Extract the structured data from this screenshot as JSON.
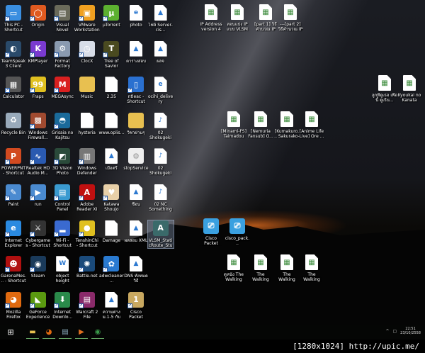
{
  "desktop": {
    "grid": [
      {
        "label": "This PC - Shortcut",
        "icon": "computer-icon",
        "color": "#3a8ee0",
        "glyph": "▭"
      },
      {
        "label": "Origin",
        "icon": "origin-icon",
        "color": "#e05a20",
        "glyph": "◯"
      },
      {
        "label": "Visual Novel Reader - S...",
        "icon": "vnr-icon",
        "color": "#6a6a5a",
        "glyph": "▤"
      },
      {
        "label": "VMware Workstation",
        "icon": "vmware-icon",
        "color": "#f0a020",
        "glyph": "▣"
      },
      {
        "label": "µTorrent",
        "icon": "utorrent-icon",
        "color": "#5cb030",
        "glyph": "µ"
      },
      {
        "label": "photo",
        "icon": "dreamweaver-file-icon",
        "color": "doc",
        "glyph": "e"
      },
      {
        "label": "ไฟล์ Server-cis...",
        "icon": "image-file-icon",
        "color": "doc",
        "glyph": "▲"
      },
      {
        "label": "TeamSpeak 3 Client",
        "icon": "teamspeak-icon",
        "color": "#2a4a6a",
        "glyph": "◐"
      },
      {
        "label": "KMPlayer",
        "icon": "kmplayer-icon",
        "color": "#7a3ad0",
        "glyph": "K"
      },
      {
        "label": "Format Factory",
        "icon": "format-factory-icon",
        "color": "#8a9ab0",
        "glyph": "⚙"
      },
      {
        "label": "ClocX",
        "icon": "clock-icon",
        "color": "#d8dde8",
        "glyph": "◷"
      },
      {
        "label": "Tree of Savior (English Ver.)",
        "icon": "tree-of-savior-icon",
        "color": "#4a4a20",
        "glyph": "T"
      },
      {
        "label": "ตารางสอบ",
        "icon": "image-file-icon",
        "color": "doc",
        "glyph": "▲"
      },
      {
        "label": "ผลจ",
        "icon": "image-file-icon",
        "color": "doc",
        "glyph": "▲"
      },
      {
        "label": "Calculator",
        "icon": "calculator-icon",
        "color": "#555",
        "glyph": "▦"
      },
      {
        "label": "Fraps",
        "icon": "fraps-icon",
        "color": "#e0c020",
        "glyph": "99"
      },
      {
        "label": "MEGAsync",
        "icon": "mega-icon",
        "color": "#d92020",
        "glyph": "M"
      },
      {
        "label": "Music",
        "icon": "folder-icon",
        "color": "#e8c050",
        "glyph": ""
      },
      {
        "label": "2.35",
        "icon": "blank-file-icon",
        "color": "doc",
        "glyph": ""
      },
      {
        "label": "ntleac - Shortcut",
        "icon": "window-icon",
        "color": "#2a70d0",
        "glyph": "▯"
      },
      {
        "label": "ocihi_delivery",
        "icon": "pdf-file-icon",
        "color": "doc",
        "glyph": "e"
      },
      {
        "label": "Recycle Bin",
        "icon": "recycle-bin-icon",
        "color": "#9ab",
        "glyph": "♻"
      },
      {
        "label": "Windows Firewall...",
        "icon": "firewall-icon",
        "color": "#a04a30",
        "glyph": "▩"
      },
      {
        "label": "Grisaia no Kajitsu",
        "icon": "grisaia-icon",
        "color": "#1a6a9a",
        "glyph": "◓"
      },
      {
        "label": "hysteria",
        "icon": "blank-file-icon",
        "color": "doc",
        "glyph": ""
      },
      {
        "label": "www.oplis...",
        "icon": "blank-file-icon",
        "color": "doc",
        "glyph": ""
      },
      {
        "label": "วิชาผ่านๆ",
        "icon": "folder-icon",
        "color": "#e8c050",
        "glyph": ""
      },
      {
        "label": "02 Shokugeki no Soma E...",
        "icon": "mp3-file-icon",
        "color": "doc",
        "glyph": "♪"
      },
      {
        "label": "POWERPNT - Shortcut",
        "icon": "powerpoint-icon",
        "color": "#d24a20",
        "glyph": "P"
      },
      {
        "label": "Realtek HD Audio M...",
        "icon": "realtek-icon",
        "color": "#2a5ab0",
        "glyph": "∿"
      },
      {
        "label": "3D Vision Photo Viewer",
        "icon": "3d-vision-icon",
        "color": "#2a4a3a",
        "glyph": "◩"
      },
      {
        "label": "Windows Defender",
        "icon": "defender-icon",
        "color": "#777",
        "glyph": "▥"
      },
      {
        "label": "เมื่อตรี",
        "icon": "image-file-icon",
        "color": "doc",
        "glyph": "▲"
      },
      {
        "label": "stopService",
        "icon": "settings-file-icon",
        "color": "#eee",
        "glyph": "⚙"
      },
      {
        "label": "02 Shokugeki no Soma E...",
        "icon": "mp3-file-icon",
        "color": "doc",
        "glyph": "♪"
      },
      {
        "label": "Paint",
        "icon": "paint-icon",
        "color": "#4a8ad0",
        "glyph": "✎"
      },
      {
        "label": "run",
        "icon": "run-icon",
        "color": "#4a8ad0",
        "glyph": "▶"
      },
      {
        "label": "Control Panel",
        "icon": "control-panel-icon",
        "color": "#3a9ad0",
        "glyph": "▤"
      },
      {
        "label": "Adobe Reader XI",
        "icon": "adobe-reader-icon",
        "color": "#c01010",
        "glyph": "A"
      },
      {
        "label": "Katawa Shoujo",
        "icon": "heart-icon",
        "color": "#e8d0a8",
        "glyph": "♥"
      },
      {
        "label": "ชื่อน",
        "icon": "image-file-icon",
        "color": "doc",
        "glyph": "▲"
      },
      {
        "label": "02 NC Something ...",
        "icon": "mp3-file-icon",
        "color": "doc",
        "glyph": "♪"
      },
      {
        "label": "Internet Explorer",
        "icon": "internet-explorer-icon",
        "color": "#2a8ae0",
        "glyph": "e"
      },
      {
        "label": "Cybergames - Shortcut",
        "icon": "cybergames-icon",
        "color": "#333",
        "glyph": "⚔"
      },
      {
        "label": "Wi-Fi - Shortcut",
        "icon": "wifi-icon",
        "color": "#3a6ad0",
        "glyph": "▂"
      },
      {
        "label": "TenshinChi - Shortcut",
        "icon": "tenshin-icon",
        "color": "#e0c020",
        "glyph": "●"
      },
      {
        "label": "Damage",
        "icon": "blank-file-icon",
        "color": "doc",
        "glyph": ""
      },
      {
        "label": "ผลสอบ XML",
        "icon": "image-file-icon",
        "color": "doc",
        "glyph": "▲"
      },
      {
        "label": "VLSM_StaticRoute_Student",
        "icon": "packet-tracer-file-icon",
        "color": "#3a6a6a",
        "glyph": "A",
        "selected": true
      },
      {
        "label": "GarenaMes... - Shortcut",
        "icon": "garena-icon",
        "color": "#b01010",
        "glyph": "☻"
      },
      {
        "label": "Steam",
        "icon": "steam-icon",
        "color": "#1a3a5a",
        "glyph": "◉"
      },
      {
        "label": "object height",
        "icon": "word-file-icon",
        "color": "doc",
        "glyph": "W"
      },
      {
        "label": "Battle.net",
        "icon": "battlenet-icon",
        "color": "#1a4a7a",
        "glyph": "✺"
      },
      {
        "label": "adwcleaner...",
        "icon": "adwcleaner-icon",
        "color": "#2a7ad0",
        "glyph": "✿"
      },
      {
        "label": "DNS ทั้งหมดวิธี",
        "icon": "image-file-icon",
        "color": "doc",
        "glyph": "▲"
      },
      null,
      {
        "label": "Mozilla Firefox",
        "icon": "firefox-icon",
        "color": "#e06a10",
        "glyph": "◕"
      },
      {
        "label": "GeForce Experience",
        "icon": "geforce-icon",
        "color": "#5a9a10",
        "glyph": "◣"
      },
      {
        "label": "Internet Downlo...",
        "icon": "idm-icon",
        "color": "#2a8a4a",
        "glyph": "⬇"
      },
      {
        "label": "Warcraft 2 File",
        "icon": "winrar-icon",
        "color": "#8a2a6a",
        "glyph": "▤"
      },
      {
        "label": "ความต่าง ม.1-5 กับ ม.6",
        "icon": "image-file-icon",
        "color": "doc",
        "glyph": "▲"
      },
      {
        "label": "Cisco Packet Tracer Stu...",
        "icon": "cisco-packet-tracer-icon",
        "color": "#c8a860",
        "glyph": "1"
      },
      null
    ],
    "free": [
      {
        "label": "IP Address version 4 ล...",
        "icon": "video-file-icon"
      },
      {
        "label": "สอนแบ่ง IP แบบ VLSM a...",
        "icon": "video-file-icon"
      },
      {
        "label": "[part 1] วิธีคำนวณ IP addr...",
        "icon": "video-file-icon"
      },
      {
        "label": "---[part 2] วิธีคำนวณ IP ad...",
        "icon": "video-file-icon"
      },
      {
        "label": "ลูกที่ดูเธอ เพื่อนี้ ดูเธิน...",
        "icon": "video-file-icon"
      },
      {
        "label": "Kyoukai no Kanata Mo...",
        "icon": "video-file-icon"
      },
      {
        "label": "[Minami-FS] Taimadou ...",
        "icon": "video-file-icon"
      },
      {
        "label": "[Nemuria Fansub] O...",
        "icon": "video-file-icon"
      },
      {
        "label": "[Kumakuro... Sakurako-s...",
        "icon": "video-file-icon"
      },
      {
        "label": "[Anime Life Live] Ore ...",
        "icon": "video-file-icon"
      },
      {
        "label": "Cisco Packet Tracer 6.2 f...",
        "icon": "installer-icon"
      },
      {
        "label": "cisco_pack...",
        "icon": "installer-icon"
      },
      {
        "label": "ดูหนัง The Walking De...",
        "icon": "video-file-icon"
      },
      {
        "label": "The Walking Dead Sea...",
        "icon": "video-file-icon"
      },
      {
        "label": "The Walking Dead Seas...",
        "icon": "video-file-icon"
      },
      {
        "label": "The Walking Dead Seas...",
        "icon": "video-file-icon"
      }
    ]
  },
  "taskbar": {
    "start": "⊞",
    "apps": [
      {
        "name": "file-explorer",
        "glyph": "▬",
        "color": "#e8c050"
      },
      {
        "name": "firefox",
        "glyph": "◕",
        "color": "#e06a10"
      },
      {
        "name": "packet-tracer",
        "glyph": "▤",
        "color": "#8ab"
      },
      {
        "name": "media-player",
        "glyph": "▶",
        "color": "#e07020"
      },
      {
        "name": "idm",
        "glyph": "◉",
        "color": "#3a9a4a"
      }
    ],
    "tray_chevron": "^",
    "time": "22:51",
    "date": "23/10/2558"
  },
  "watermark": "[1280x1024] http://upic.me/"
}
